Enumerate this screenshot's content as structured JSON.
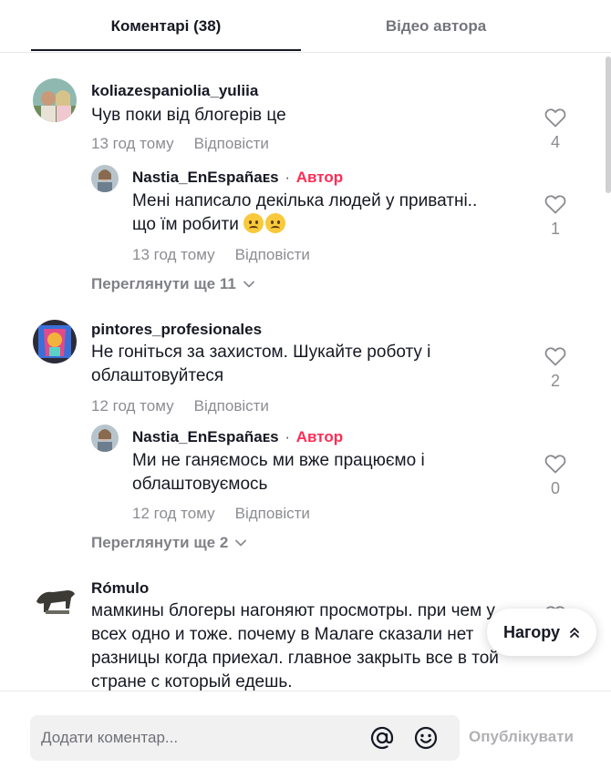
{
  "tabs": {
    "comments": "Коментарі (38)",
    "author_videos": "Відео автора"
  },
  "comments": [
    {
      "username": "koliazespaniolia_yuliia",
      "text": "Чув поки від блогерів це",
      "time": "13 год тому",
      "reply_label": "Відповісти",
      "likes": "4",
      "reply": {
        "username": "Nastia_EnEspañaᴇs",
        "separator": "·",
        "author_label": "Автор",
        "text_line1": "Мені написало декілька людей у приватні..",
        "text_line2": "що їм робити",
        "time": "13 год тому",
        "reply_label": "Відповісти",
        "likes": "1"
      },
      "view_more": "Переглянути ще 11"
    },
    {
      "username": "pintores_profesionales",
      "text_line1": "Не гоніться за захистом. Шукайте роботу і",
      "text_line2": "облаштовуйтеся",
      "time": "12 год тому",
      "reply_label": "Відповісти",
      "likes": "2",
      "reply": {
        "username": "Nastia_EnEspañaᴇs",
        "separator": "·",
        "author_label": "Автор",
        "text_line1": "Ми не ганяємось ми вже працюємо і",
        "text_line2": "облаштовуємось",
        "time": "12 год тому",
        "reply_label": "Відповісти",
        "likes": "0"
      },
      "view_more": "Переглянути ще 2"
    },
    {
      "username": "Rómulo",
      "text_line1": "мамкины блогеры нагоняют просмотры. при чем у",
      "text_line2": "всех одно и тоже. почему в Малаге сказали нет",
      "text_line3": "разницы когда приехал. главное закрыть все в той",
      "text_line4": "стране с который едешь."
    }
  ],
  "back_to_top": "Нагору",
  "composer": {
    "placeholder": "Додати коментар...",
    "post_label": "Опублікувати"
  },
  "icons": {
    "like": "heart-outline-icon",
    "at": "at-sign-icon",
    "emoji": "smiley-icon",
    "chevron": "chevron-down-icon",
    "back_top": "double-chevron-up-icon"
  },
  "colors": {
    "author": "#fe2c55",
    "text": "#161823",
    "muted": "#8a8b91"
  }
}
